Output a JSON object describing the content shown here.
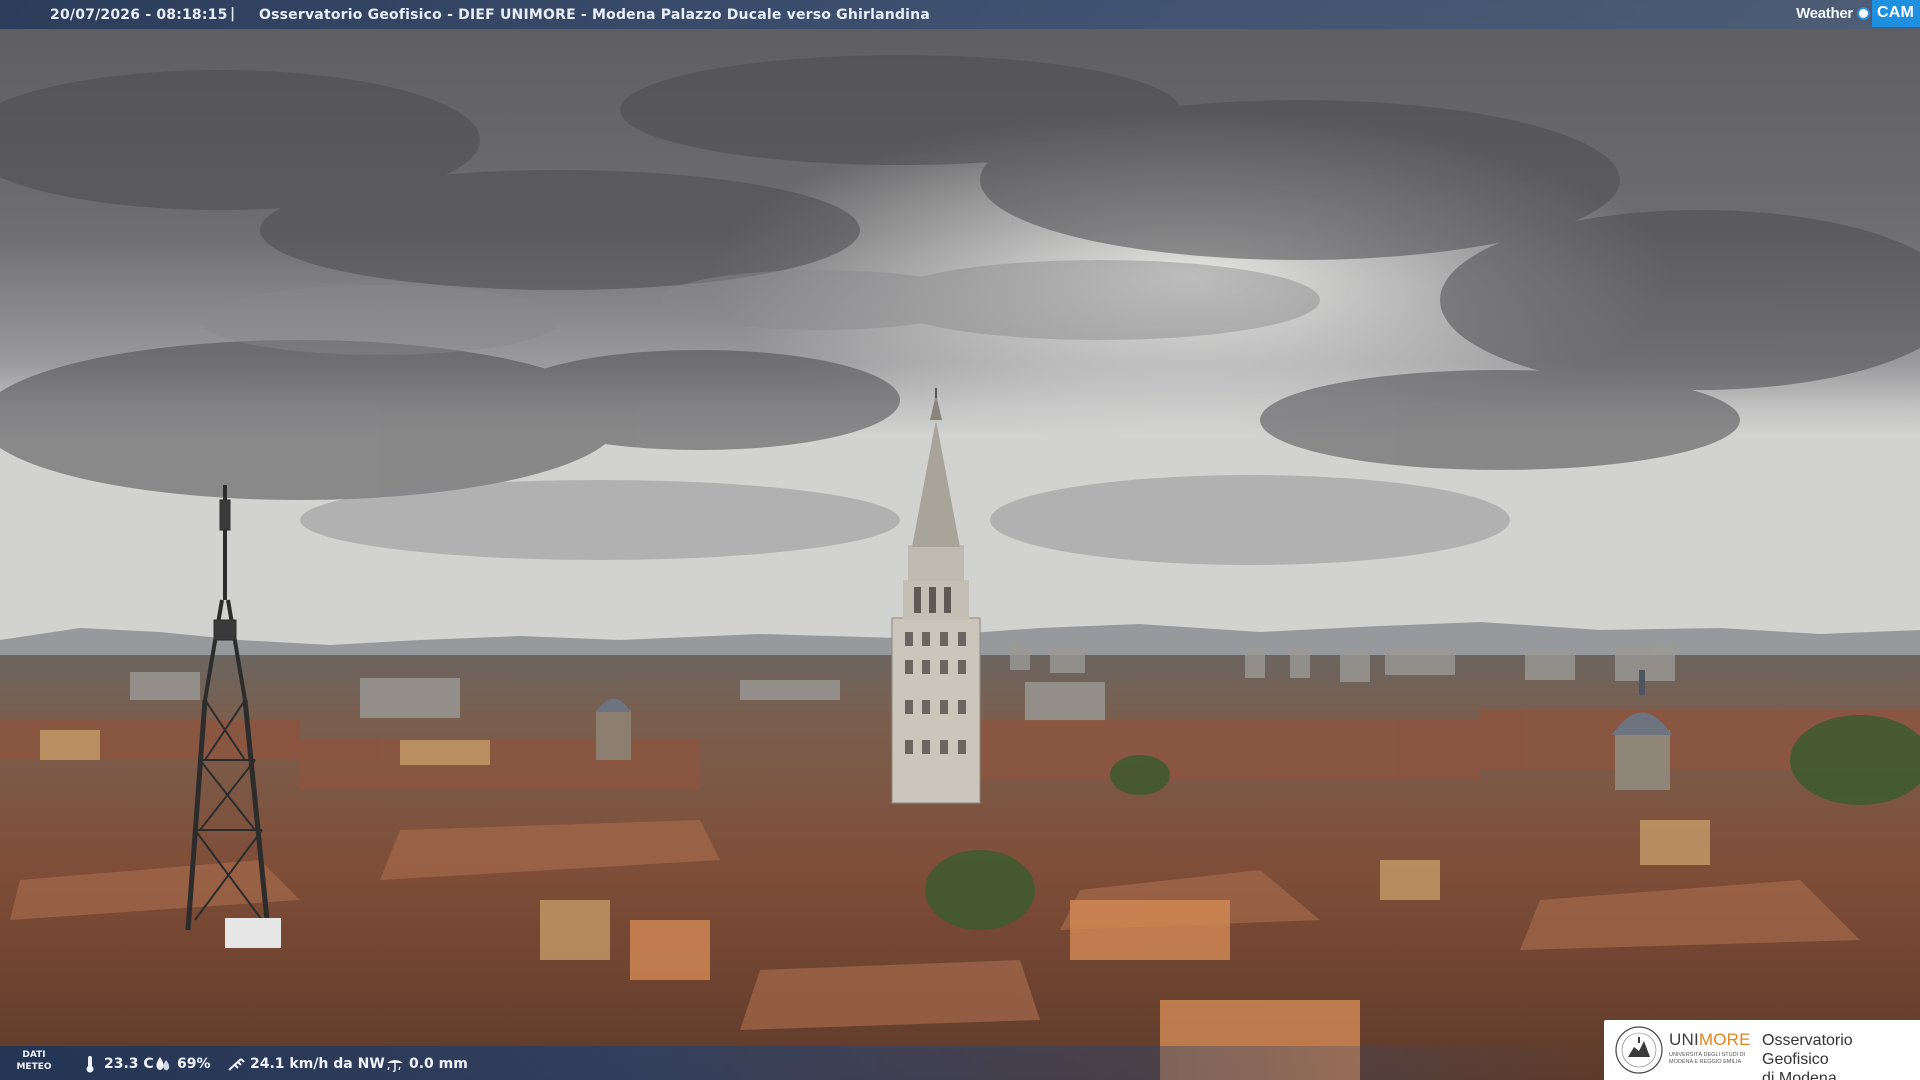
{
  "header": {
    "timestamp": "20/07/2026 - 08:18:15",
    "separator": "|",
    "title": "Osservatorio Geofisico - DIEF UNIMORE - Modena Palazzo Ducale verso Ghirlandina"
  },
  "brand": {
    "weather_text": "Weather",
    "cam_text": "CAM",
    "cam_color": "#1f8fe0"
  },
  "weather_data": {
    "label": "DATI\nMETEO",
    "label_line1": "DATI",
    "label_line2": "METEO",
    "temperature": "23.3 C",
    "temperature_icon": "thermometer-icon",
    "humidity": "69%",
    "humidity_icon": "water-drop-icon",
    "wind": "24.1 km/h da NW",
    "wind_icon": "wind-icon",
    "rain": "0.0 mm",
    "rain_icon": "rain-icon"
  },
  "institution": {
    "name_part1": "UNI",
    "name_part2": "MORE",
    "subtitle": "UNIVERSITÀ DEGLI STUDI DI MODENA E REGGIO EMILIA",
    "observatory_line1": "Osservatorio Geofisico",
    "observatory_line2": "di Modena",
    "accent_color": "#e2851f"
  },
  "colors": {
    "bar_background": "#2c446e",
    "sky": "#8c8c8c",
    "roofs": "#7a4a36"
  }
}
